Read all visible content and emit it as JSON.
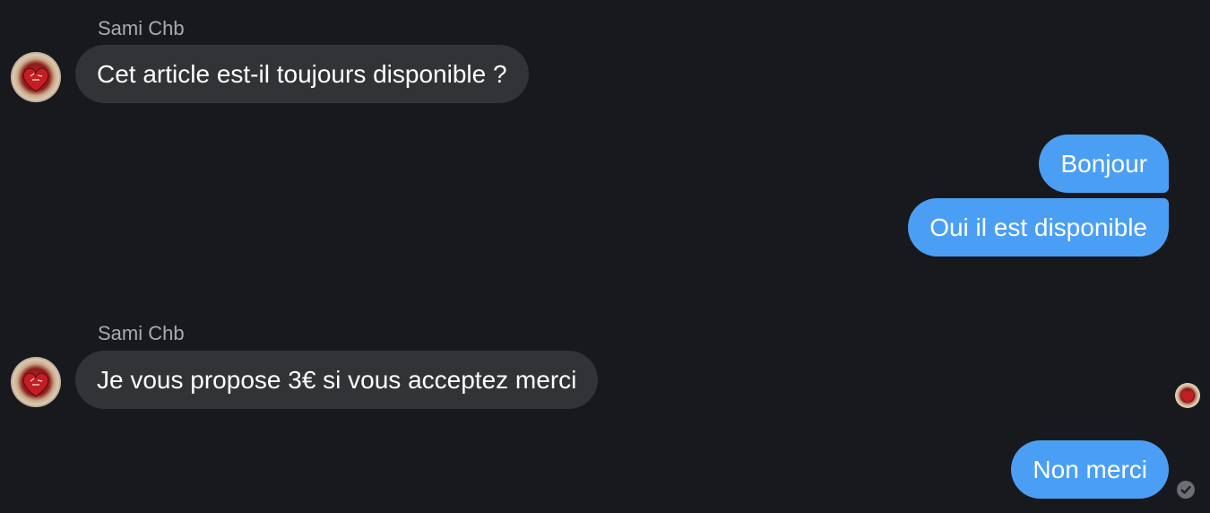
{
  "messages": [
    {
      "sender": "Sami Chb",
      "text": "Cet article est-il toujours disponible ?",
      "direction": "incoming"
    },
    {
      "text": "Bonjour",
      "direction": "outgoing"
    },
    {
      "text": "Oui il est disponible",
      "direction": "outgoing"
    },
    {
      "sender": "Sami Chb",
      "text": "Je vous propose 3€ si vous acceptez merci",
      "direction": "incoming"
    },
    {
      "text": "Non merci",
      "direction": "outgoing"
    }
  ],
  "icons": {
    "avatar": "profile-avatar-heart",
    "seen": "read-receipt-avatar",
    "sent": "check-circle-icon"
  },
  "colors": {
    "background": "#18191c",
    "incoming_bubble": "#323336",
    "outgoing_bubble": "#4a9ff5",
    "sender_name": "#a8abaf"
  }
}
